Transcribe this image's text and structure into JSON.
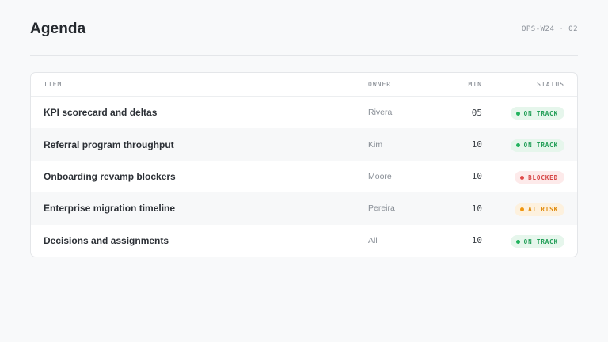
{
  "header": {
    "title": "Agenda",
    "code": "OPS-W24 · 02"
  },
  "table": {
    "columns": {
      "item": "ITEM",
      "owner": "OWNER",
      "min": "MIN",
      "status": "STATUS"
    },
    "rows": [
      {
        "item": "KPI scorecard and deltas",
        "owner": "Rivera",
        "min": "05",
        "status": "ON TRACK",
        "status_kind": "on-track"
      },
      {
        "item": "Referral program throughput",
        "owner": "Kim",
        "min": "10",
        "status": "ON TRACK",
        "status_kind": "on-track"
      },
      {
        "item": "Onboarding revamp blockers",
        "owner": "Moore",
        "min": "10",
        "status": "BLOCKED",
        "status_kind": "blocked"
      },
      {
        "item": "Enterprise migration timeline",
        "owner": "Pereira",
        "min": "10",
        "status": "AT RISK",
        "status_kind": "at-risk"
      },
      {
        "item": "Decisions and assignments",
        "owner": "All",
        "min": "10",
        "status": "ON TRACK",
        "status_kind": "on-track"
      }
    ]
  },
  "status_colors": {
    "on-track": {
      "text": "#1f9d55",
      "bg": "#e6f6ec",
      "dot": "#22b35e"
    },
    "blocked": {
      "text": "#d64545",
      "bg": "#fdeaea",
      "dot": "#e04848"
    },
    "at-risk": {
      "text": "#e08a0b",
      "bg": "#fdf1de",
      "dot": "#f0960f"
    }
  }
}
